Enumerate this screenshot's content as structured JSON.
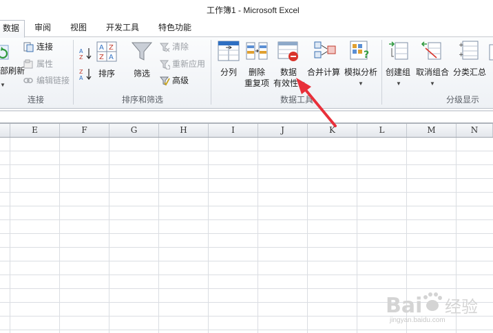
{
  "window": {
    "title": "工作簿1 - Microsoft Excel"
  },
  "tabs": [
    {
      "label": "数据",
      "active": true
    },
    {
      "label": "审阅",
      "active": false
    },
    {
      "label": "视图",
      "active": false
    },
    {
      "label": "开发工具",
      "active": false
    },
    {
      "label": "特色功能",
      "active": false
    }
  ],
  "ribbon": {
    "connections": {
      "refresh_label": "部刷新",
      "connect_label": "连接",
      "properties_label": "属性",
      "edit_links_label": "编辑链接",
      "group_label": "连接"
    },
    "sort_filter": {
      "sort_label": "排序",
      "filter_label": "筛选",
      "clear_label": "清除",
      "reapply_label": "重新应用",
      "advanced_label": "高级",
      "group_label": "排序和筛选"
    },
    "data_tools": {
      "text_to_columns_label": "分列",
      "remove_duplicates_line1": "删除",
      "remove_duplicates_line2": "重复项",
      "data_validation_line1": "数据",
      "data_validation_line2": "有效性",
      "consolidate_label": "合并计算",
      "what_if_label": "模拟分析",
      "group_label": "数据工具"
    },
    "outline": {
      "group_label_btn": "创建组",
      "ungroup_label": "取消组合",
      "subtotal_label": "分类汇总",
      "group_label": "分级显示"
    }
  },
  "sheet": {
    "columns": [
      "E",
      "F",
      "G",
      "H",
      "I",
      "J",
      "K",
      "L",
      "M",
      "N"
    ]
  },
  "watermark": {
    "brand": "Bai 经验",
    "url": "jingyan.baidu.com"
  },
  "colors": {
    "arrow": "#e8303a",
    "accent": "#2e6fc2"
  }
}
